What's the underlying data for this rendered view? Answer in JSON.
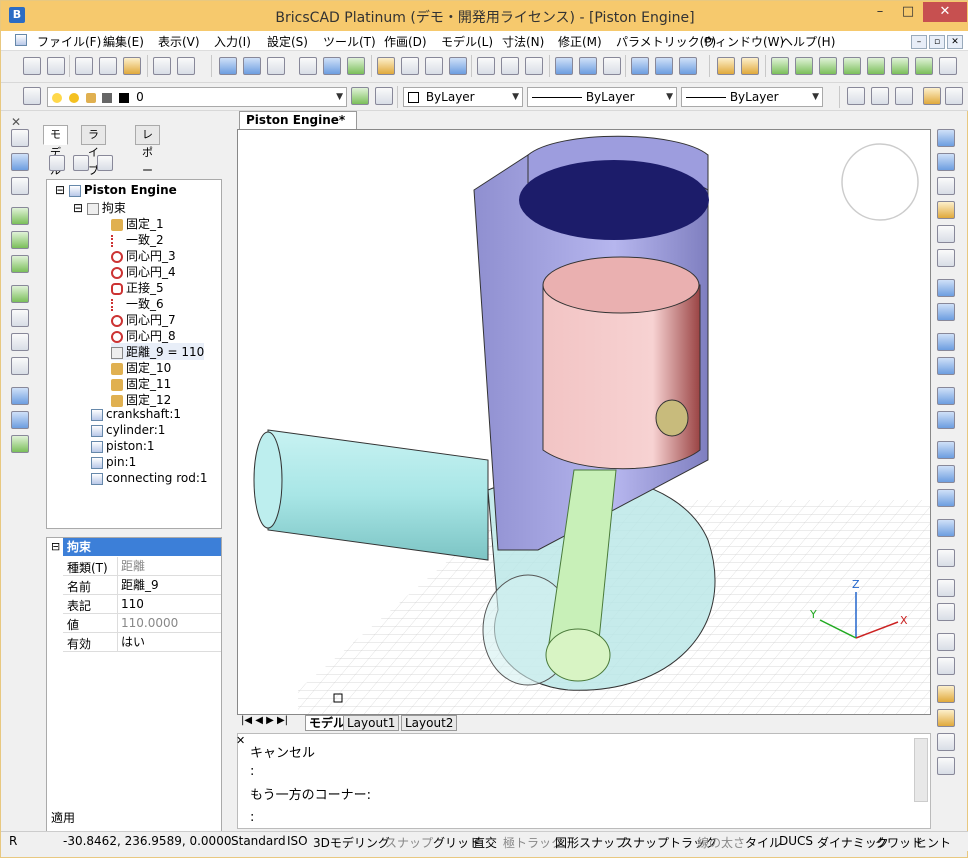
{
  "window": {
    "title": "BricsCAD Platinum (デモ・開発用ライセンス) - [Piston Engine]",
    "minimize": "–",
    "maximize": "□",
    "close": "✕"
  },
  "menu": [
    "ファイル(F)",
    "編集(E)",
    "表示(V)",
    "入力(I)",
    "設定(S)",
    "ツール(T)",
    "作画(D)",
    "モデル(L)",
    "寸法(N)",
    "修正(M)",
    "パラメトリック(P)",
    "ウィンドウ(W)",
    "ヘルプ(H)"
  ],
  "mdi": [
    "–",
    "▫",
    "✕"
  ],
  "toolbar2": {
    "layer": "0",
    "color": "ByLayer",
    "linetype": "ByLayer",
    "lineweight": "ByLayer"
  },
  "panel": {
    "close": "✕",
    "tabs": [
      "モデル",
      "ライブラリ",
      "レポート"
    ],
    "tree": {
      "root": "Piston Engine",
      "group": "拘束",
      "constraints": [
        "固定_1",
        "一致_2",
        "同心円_3",
        "同心円_4",
        "正接_5",
        "一致_6",
        "同心円_7",
        "同心円_8",
        "距離_9 = 110",
        "固定_10",
        "固定_11",
        "固定_12"
      ],
      "parts": [
        "crankshaft:1",
        "cylinder:1",
        "piston:1",
        "pin:1",
        "connecting rod:1"
      ]
    },
    "properties": {
      "header": "拘束",
      "rows": [
        {
          "k": "種類(T)",
          "v": "距離"
        },
        {
          "k": "名前",
          "v": "距離_9"
        },
        {
          "k": "表記",
          "v": "110"
        },
        {
          "k": "値",
          "v": "110.0000"
        },
        {
          "k": "有効",
          "v": "はい"
        }
      ]
    },
    "apply": "適用"
  },
  "doc_tab": "Piston Engine*",
  "layout_tabs": [
    "モデル",
    "Layout1",
    "Layout2"
  ],
  "axes": {
    "x": "X",
    "y": "Y",
    "z": "Z"
  },
  "cmdline": [
    "キャンセル",
    ":",
    "もう一方のコーナー:",
    ":"
  ],
  "status": {
    "mode": "R",
    "coords": "-30.8462, 236.9589, 0.0000",
    "items": [
      {
        "t": "Standard",
        "on": true
      },
      {
        "t": "ISO",
        "on": true
      },
      {
        "t": "3Dモデリング",
        "on": true
      },
      {
        "t": "スナップ",
        "on": false
      },
      {
        "t": "グリッド",
        "on": true
      },
      {
        "t": "直交",
        "on": true
      },
      {
        "t": "極トラック",
        "on": false
      },
      {
        "t": "図形スナップ",
        "on": true
      },
      {
        "t": "スナップトラック",
        "on": true
      },
      {
        "t": "線の太さ",
        "on": false
      },
      {
        "t": "タイル",
        "on": true
      },
      {
        "t": "DUCS",
        "on": true
      },
      {
        "t": "ダイナミック",
        "on": true
      },
      {
        "t": "クワッド",
        "on": true
      },
      {
        "t": "ヒント",
        "on": true
      }
    ]
  }
}
